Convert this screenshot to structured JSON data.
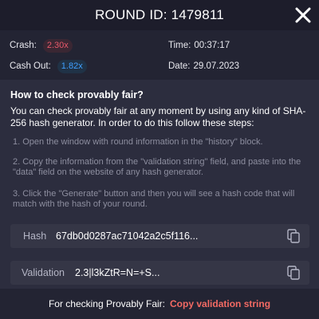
{
  "header": {
    "title": "ROUND ID: 1479811",
    "close_icon": "close-icon"
  },
  "round_info": {
    "crash_label": "Crash:",
    "crash_value": "2.30x",
    "cashout_label": "Cash Out:",
    "cashout_value": "1.82x",
    "time_label": "Time:",
    "time_value": "00:37:17",
    "date_label": "Date:",
    "date_value": "29.07.2023"
  },
  "howto": {
    "title": "How to check provably fair?",
    "description": "You can check provably fair at any moment by using any kind of SHA-256 hash generator. In order to do this follow these steps:",
    "steps": [
      "1. Open the window with round information in the \"history\" block.",
      "2. Copy the information from the \"validation string\" field, and paste into the \"data\" field on the website of any hash generator.",
      "3. Click the \"Generate\" button and then you will see a hash code that will match with the hash of your round."
    ]
  },
  "fields": {
    "hash_label": "Hash",
    "hash_value": "67db0d0287ac71042a2c5f116...",
    "validation_label": "Validation",
    "validation_value": "2.3|l3kZtR=N=+S..."
  },
  "footer": {
    "text": "For checking Provably Fair:",
    "link": "Copy validation string"
  },
  "colors": {
    "background": "#2c2d3e",
    "header": "#1d1d2b",
    "crash": "#e8586a",
    "cashout": "#3f9fff",
    "link": "#f36a63"
  }
}
